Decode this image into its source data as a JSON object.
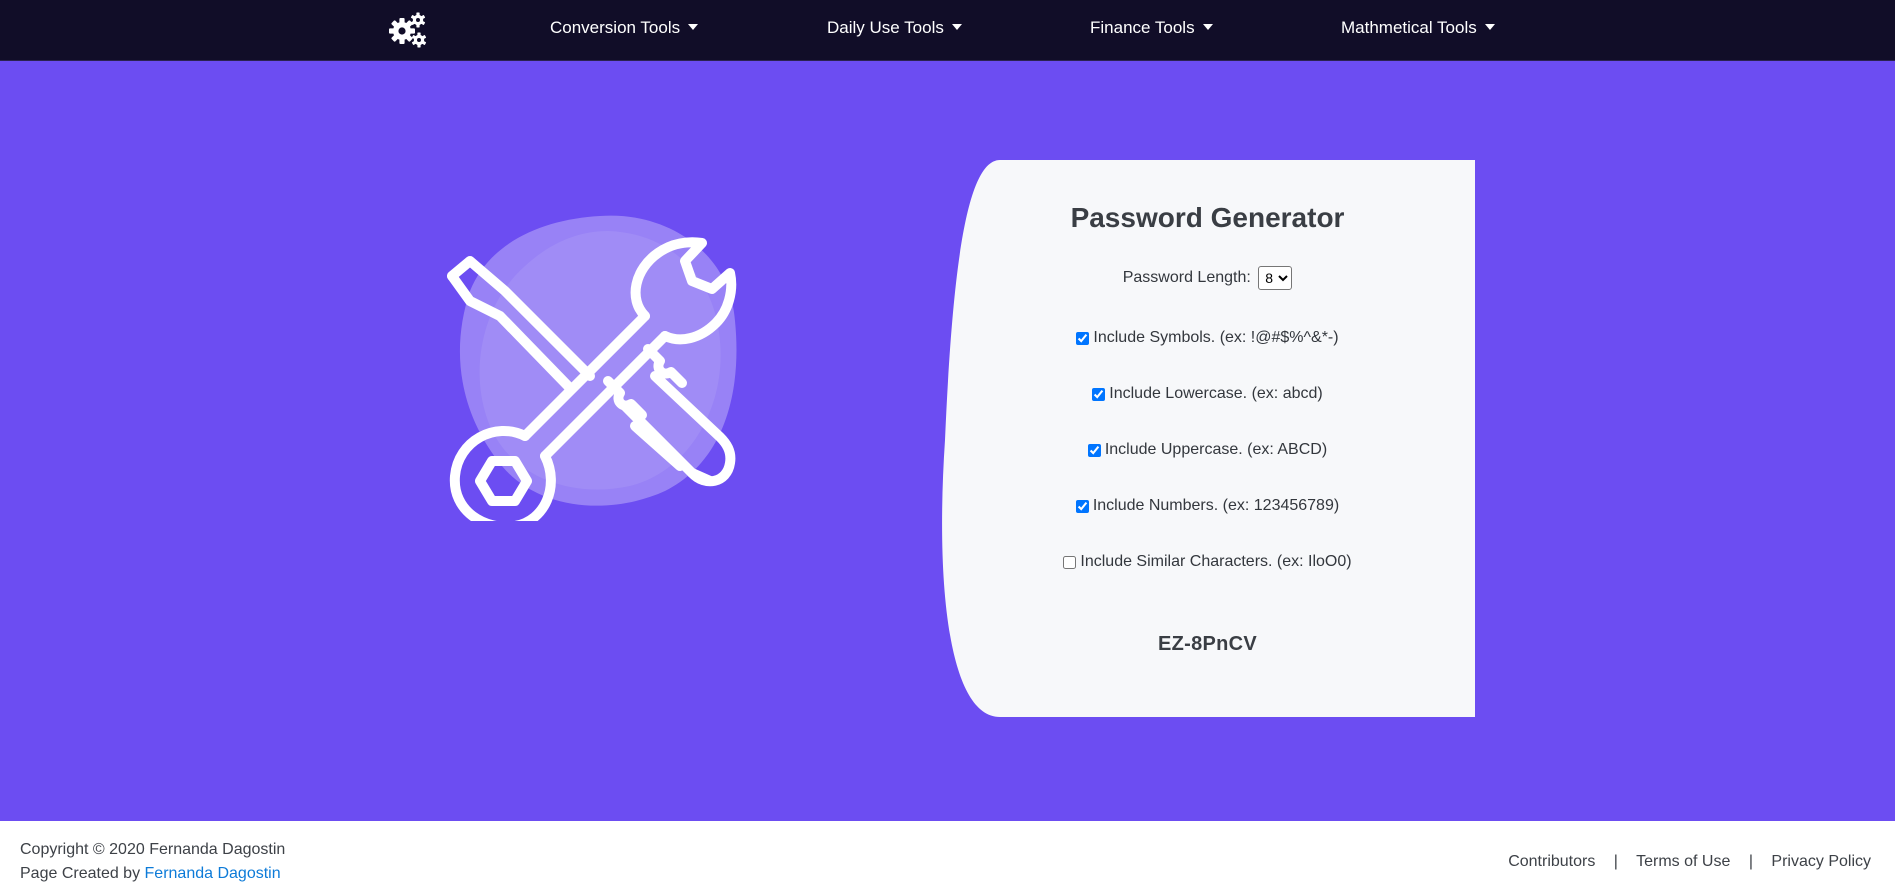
{
  "navbar": {
    "logo_icon": "gears-icon",
    "items": [
      {
        "label": "Conversion Tools"
      },
      {
        "label": "Daily Use Tools"
      },
      {
        "label": "Finance Tools"
      },
      {
        "label": "Mathmetical Tools"
      }
    ],
    "background": "#110d28"
  },
  "hero": {
    "background": "#6c4df2",
    "illustration_icon": "wrench-screwdriver-icon"
  },
  "generator": {
    "title": "Password Generator",
    "length_label": "Password Length:",
    "length_value": "8",
    "options": [
      {
        "label": "Include Symbols. (ex: !@#$%^&*-)",
        "checked": true
      },
      {
        "label": "Include Lowercase. (ex: abcd)",
        "checked": true
      },
      {
        "label": "Include Uppercase. (ex: ABCD)",
        "checked": true
      },
      {
        "label": "Include Numbers. (ex: 123456789)",
        "checked": true
      },
      {
        "label": "Include Similar Characters. (ex: IloO0)",
        "checked": false
      }
    ],
    "result": "EZ-8PnCV",
    "card_color": "#f7f8fa"
  },
  "footer": {
    "copyright": "Copyright © 2020 Fernanda Dagostin",
    "created_prefix": "Page Created by ",
    "created_link": "Fernanda Dagostin",
    "links": [
      "Contributors",
      "Terms of Use",
      "Privacy Policy"
    ],
    "separator": "|"
  }
}
